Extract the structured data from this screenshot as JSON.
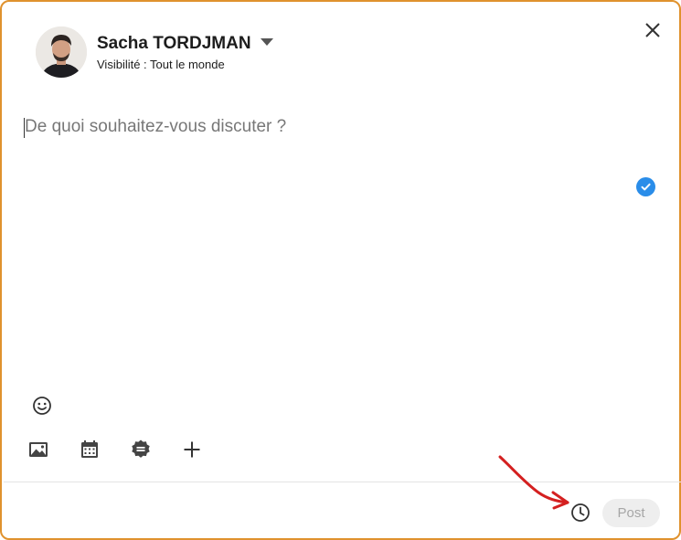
{
  "author": {
    "name": "Sacha TORDJMAN",
    "visibility": "Visibilité : Tout le monde"
  },
  "composer": {
    "placeholder": "De quoi souhaitez-vous discuter ?"
  },
  "toolbar": {
    "icons": [
      "emoji-icon",
      "image-icon",
      "calendar-icon",
      "badge-icon",
      "plus-icon"
    ]
  },
  "footer": {
    "post_label": "Post"
  },
  "colors": {
    "frame_border": "#e0922e",
    "check_badge": "#2a8de9",
    "annotation_arrow": "#d42020"
  }
}
